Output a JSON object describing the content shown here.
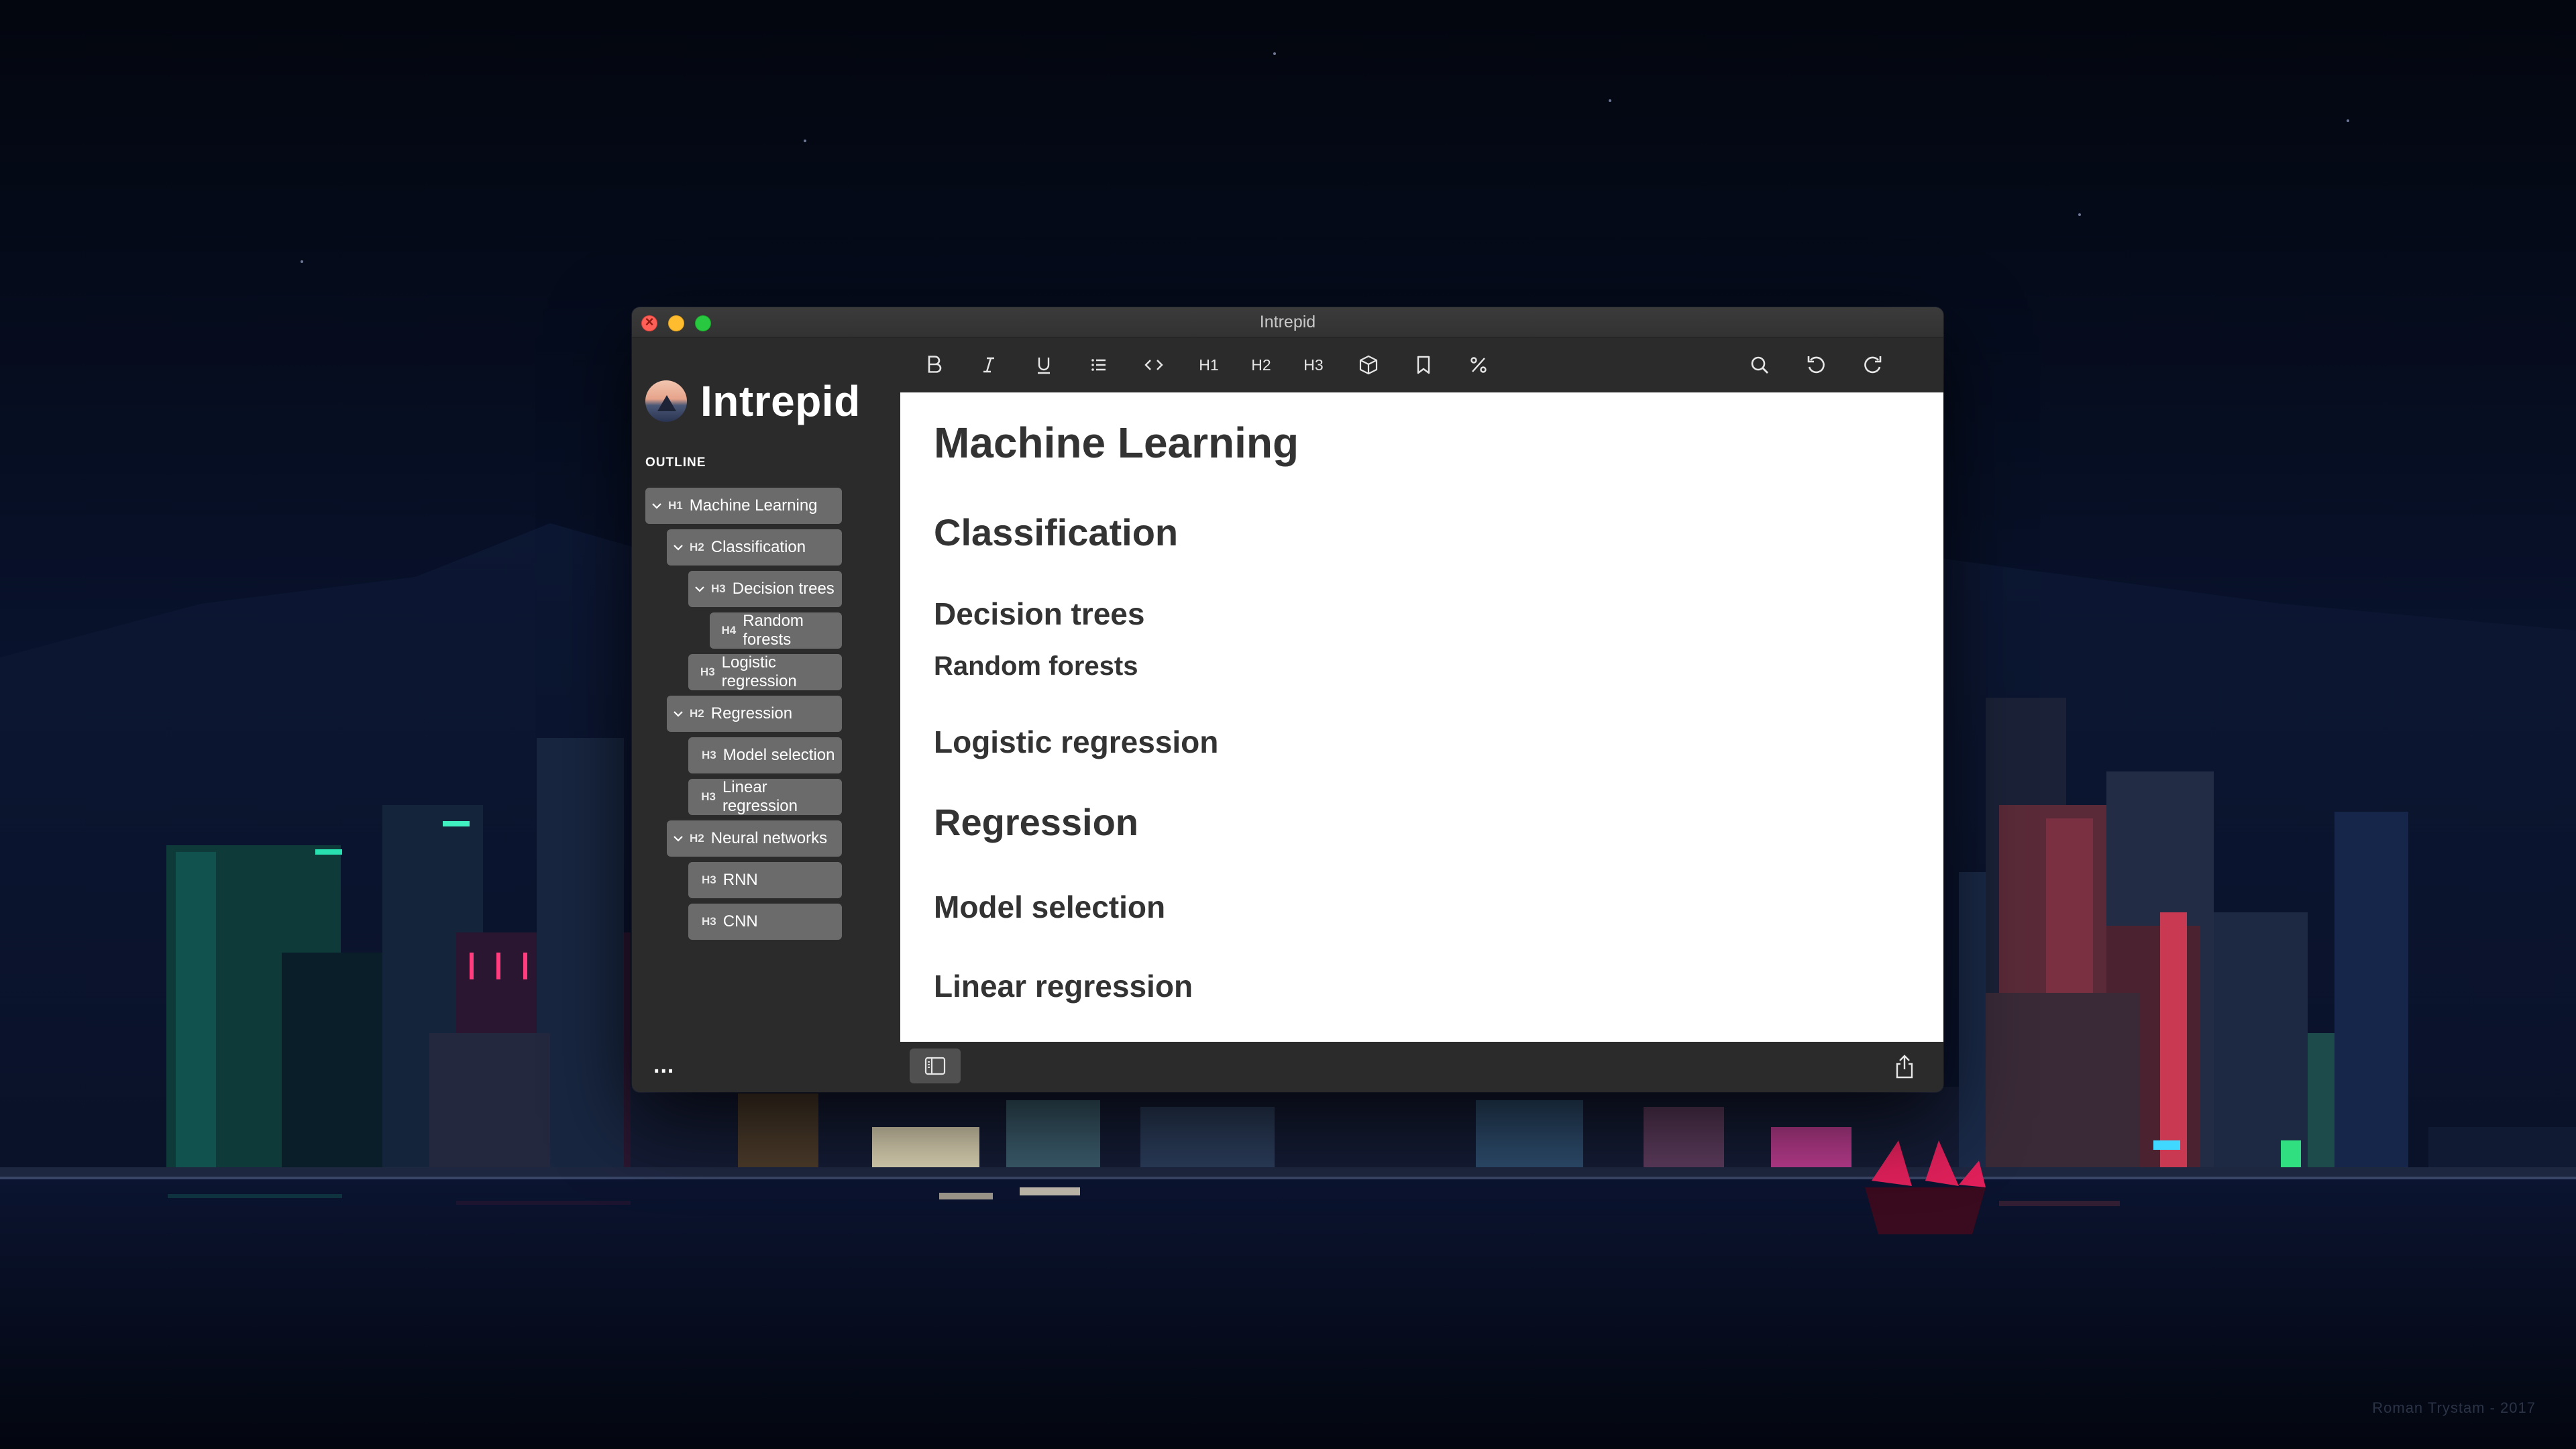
{
  "window": {
    "title": "Intrepid"
  },
  "sidebar": {
    "app_name": "Intrepid",
    "outline_label": "OUTLINE",
    "more_label": "...",
    "items": [
      {
        "level": "H1",
        "label": "Machine Learning",
        "expanded": true
      },
      {
        "level": "H2",
        "label": "Classification",
        "expanded": true
      },
      {
        "level": "H3",
        "label": "Decision trees",
        "expanded": true
      },
      {
        "level": "H4",
        "label": "Random forests",
        "expanded": false
      },
      {
        "level": "H3",
        "label": "Logistic regression",
        "expanded": false
      },
      {
        "level": "H2",
        "label": "Regression",
        "expanded": true
      },
      {
        "level": "H3",
        "label": "Model selection",
        "expanded": false
      },
      {
        "level": "H3",
        "label": "Linear regression",
        "expanded": false
      },
      {
        "level": "H2",
        "label": "Neural networks",
        "expanded": true
      },
      {
        "level": "H3",
        "label": "RNN",
        "expanded": false
      },
      {
        "level": "H3",
        "label": "CNN",
        "expanded": false
      }
    ]
  },
  "toolbar": {
    "bold_icon": "bold-icon",
    "italic_icon": "italic-icon",
    "underline_icon": "underline-icon",
    "list_icon": "bulleted-list-icon",
    "code_icon": "code-icon",
    "h1_label": "H1",
    "h2_label": "H2",
    "h3_label": "H3",
    "cube_icon": "cube-icon",
    "bookmark_icon": "bookmark-icon",
    "percent_icon": "percent-icon",
    "search_icon": "search-icon",
    "undo_icon": "undo-icon",
    "redo_icon": "redo-icon"
  },
  "document": {
    "headings": [
      {
        "level": 1,
        "text": "Machine Learning"
      },
      {
        "level": 2,
        "text": "Classification"
      },
      {
        "level": 3,
        "text": "Decision trees"
      },
      {
        "level": 4,
        "text": "Random forests"
      },
      {
        "level": 3,
        "text": "Logistic regression"
      },
      {
        "level": 2,
        "text": "Regression"
      },
      {
        "level": 3,
        "text": "Model selection"
      },
      {
        "level": 3,
        "text": "Linear regression"
      }
    ]
  },
  "bottombar": {
    "sidebar_toggle_icon": "sidebar-toggle-icon",
    "share_icon": "share-icon"
  },
  "wallpaper": {
    "credit": "Roman Trystam - 2017"
  },
  "colors": {
    "window_chrome": "#2b2b2b",
    "outline_item": "#6b6b6b",
    "editor_bg": "#ffffff",
    "heading_text": "#333333",
    "close": "#fe5f57",
    "minimize": "#febc2e",
    "maximize": "#28c840"
  }
}
